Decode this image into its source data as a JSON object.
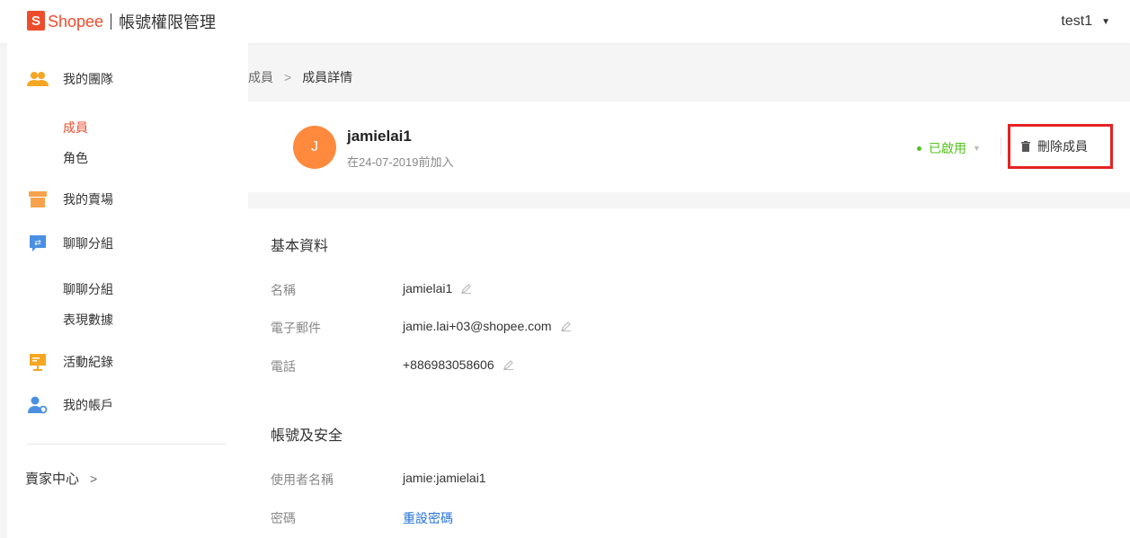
{
  "header": {
    "logo_glyph": "S",
    "brand": "Shopee",
    "title": "帳號權限管理",
    "user": "test1"
  },
  "sidebar": {
    "groups": [
      {
        "label": "我的團隊",
        "icon": "team-icon",
        "children": [
          "成員",
          "角色"
        ],
        "active_child": "成員"
      },
      {
        "label": "我的賣場",
        "icon": "shop-icon"
      },
      {
        "label": "聊聊分組",
        "icon": "chat-group-icon",
        "children": [
          "聊聊分組",
          "表現數據"
        ]
      },
      {
        "label": "活動紀錄",
        "icon": "activity-log-icon"
      },
      {
        "label": "我的帳戶",
        "icon": "account-icon"
      }
    ],
    "seller_center": "賣家中心"
  },
  "breadcrumb": {
    "parent": "成員",
    "current": "成員詳情"
  },
  "member": {
    "initial": "J",
    "name": "jamielai1",
    "joined": "在24-07-2019前加入",
    "status": "已啟用",
    "delete_label": "刪除成員"
  },
  "basic_info": {
    "title": "基本資料",
    "fields": [
      {
        "label": "名稱",
        "value": "jamielai1"
      },
      {
        "label": "電子郵件",
        "value": "jamie.lai+03@shopee.com"
      },
      {
        "label": "電話",
        "value": "+886983058606"
      }
    ]
  },
  "security": {
    "title": "帳號及安全",
    "fields": [
      {
        "label": "使用者名稱",
        "value": "jamie:jamielai1"
      },
      {
        "label": "密碼",
        "value": "重設密碼"
      }
    ]
  },
  "colors": {
    "brand": "#ee4d2d",
    "active_status": "#52c41a",
    "link": "#2673dd",
    "highlight_box": "#e52222"
  }
}
